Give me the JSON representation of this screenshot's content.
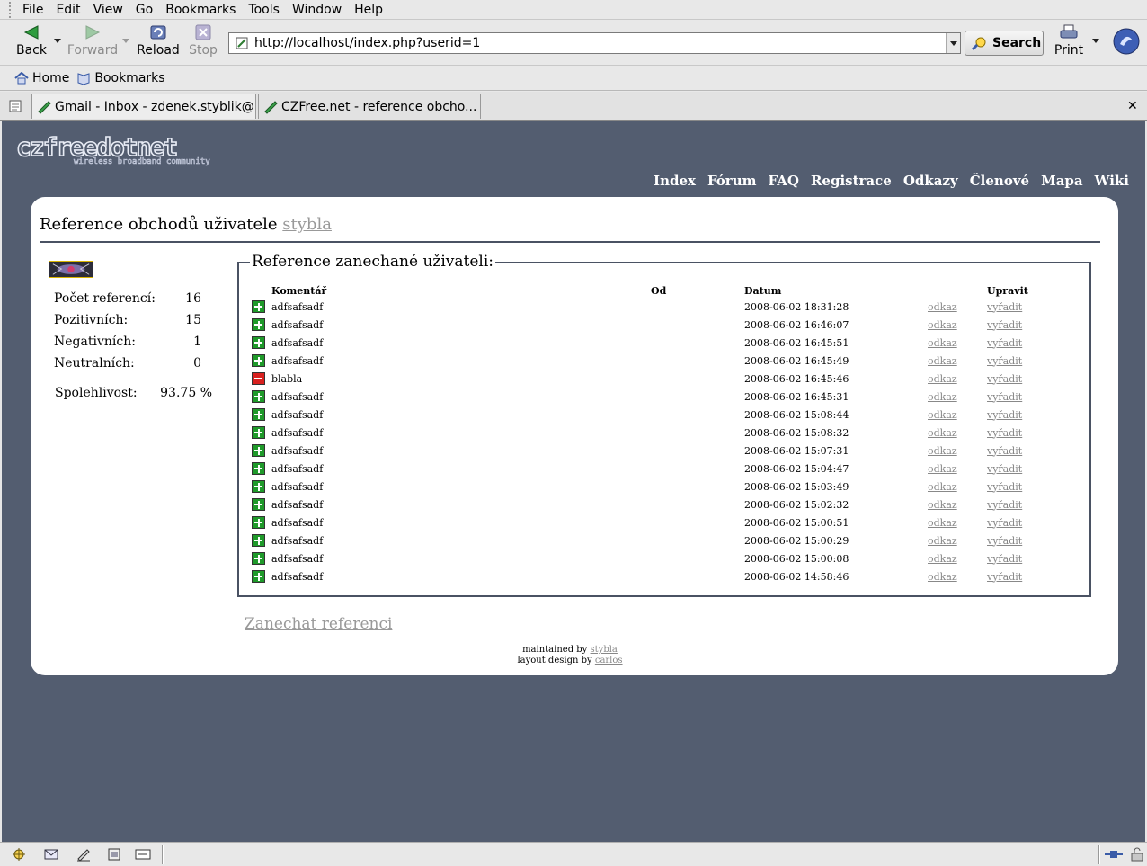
{
  "menu": [
    "File",
    "Edit",
    "View",
    "Go",
    "Bookmarks",
    "Tools",
    "Window",
    "Help"
  ],
  "toolbar": {
    "back": "Back",
    "forward": "Forward",
    "reload": "Reload",
    "stop": "Stop",
    "url": "http://localhost/index.php?userid=1",
    "search": "Search",
    "print": "Print"
  },
  "bookmarks_bar": {
    "home": "Home",
    "bookmarks": "Bookmarks"
  },
  "tabs": [
    {
      "title": "Gmail - Inbox - zdenek.styblik@..."
    },
    {
      "title": "CZFree.net - reference obcho..."
    }
  ],
  "site": {
    "nav": [
      "Index",
      "Fórum",
      "FAQ",
      "Registrace",
      "Odkazy",
      "Členové",
      "Mapa",
      "Wiki"
    ],
    "title_prefix": "Reference obchodů uživatele",
    "title_user": "stybla",
    "stats": [
      {
        "label": "Počet referencí:",
        "value": "16"
      },
      {
        "label": "Pozitivních:",
        "value": "15"
      },
      {
        "label": "Negativních:",
        "value": "1"
      },
      {
        "label": "Neutralních:",
        "value": "0"
      }
    ],
    "reliability": {
      "label": "Spolehlivost:",
      "value": "93.75",
      "unit": "%"
    },
    "fieldset_legend": "Reference zanechané uživateli:",
    "columns": {
      "comment": "Komentář",
      "from": "Od",
      "date": "Datum",
      "edit": "Upravit"
    },
    "link_label": "odkaz",
    "remove_label": "vyřadit",
    "references": [
      {
        "type": "positive",
        "comment": "adfsafsadf",
        "from": "",
        "date": "2008-06-02 18:31:28"
      },
      {
        "type": "positive",
        "comment": "adfsafsadf",
        "from": "",
        "date": "2008-06-02 16:46:07"
      },
      {
        "type": "positive",
        "comment": "adfsafsadf",
        "from": "",
        "date": "2008-06-02 16:45:51"
      },
      {
        "type": "positive",
        "comment": "adfsafsadf",
        "from": "",
        "date": "2008-06-02 16:45:49"
      },
      {
        "type": "negative",
        "comment": "blabla",
        "from": "",
        "date": "2008-06-02 16:45:46"
      },
      {
        "type": "positive",
        "comment": "adfsafsadf",
        "from": "",
        "date": "2008-06-02 16:45:31"
      },
      {
        "type": "positive",
        "comment": "adfsafsadf",
        "from": "",
        "date": "2008-06-02 15:08:44"
      },
      {
        "type": "positive",
        "comment": "adfsafsadf",
        "from": "",
        "date": "2008-06-02 15:08:32"
      },
      {
        "type": "positive",
        "comment": "adfsafsadf",
        "from": "",
        "date": "2008-06-02 15:07:31"
      },
      {
        "type": "positive",
        "comment": "adfsafsadf",
        "from": "",
        "date": "2008-06-02 15:04:47"
      },
      {
        "type": "positive",
        "comment": "adfsafsadf",
        "from": "",
        "date": "2008-06-02 15:03:49"
      },
      {
        "type": "positive",
        "comment": "adfsafsadf",
        "from": "",
        "date": "2008-06-02 15:02:32"
      },
      {
        "type": "positive",
        "comment": "adfsafsadf",
        "from": "",
        "date": "2008-06-02 15:00:51"
      },
      {
        "type": "positive",
        "comment": "adfsafsadf",
        "from": "",
        "date": "2008-06-02 15:00:29"
      },
      {
        "type": "positive",
        "comment": "adfsafsadf",
        "from": "",
        "date": "2008-06-02 15:00:08"
      },
      {
        "type": "positive",
        "comment": "adfsafsadf",
        "from": "",
        "date": "2008-06-02 14:58:46"
      }
    ],
    "leave_reference": "Zanechat referenci",
    "credits": {
      "maintained_prefix": "maintained by",
      "maintained_user": "stybla",
      "design_prefix": "layout design by",
      "design_user": "carlos"
    }
  },
  "colors": {
    "page_bg": "#535d70",
    "panel_bg": "#ffffff",
    "positive": "#1f9a2a",
    "negative": "#d8201e",
    "link_muted": "#888888"
  }
}
